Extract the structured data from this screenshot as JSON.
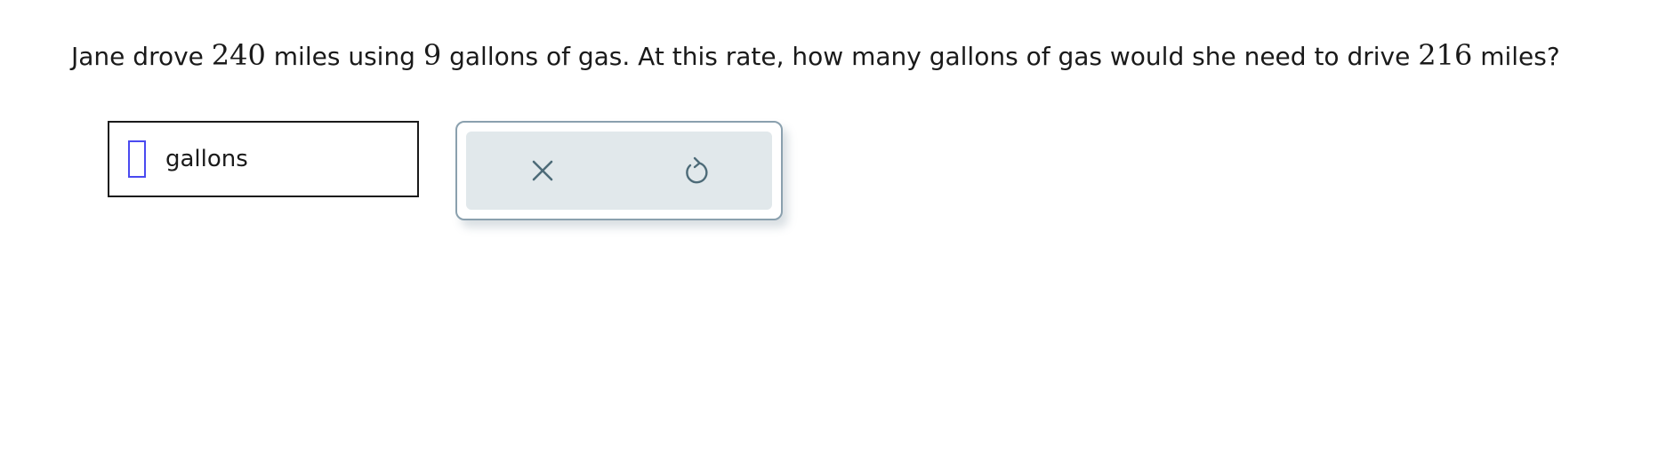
{
  "question": {
    "part1": "Jane drove ",
    "miles1": "240",
    "part2": " miles using ",
    "gallons": "9",
    "part3": " gallons of gas. At this rate, how many gallons of gas would she need to drive ",
    "miles2": "216",
    "part4": " miles?"
  },
  "answer": {
    "unit": "gallons",
    "value": ""
  },
  "keypad": {
    "clear_icon": "close-icon",
    "undo_icon": "undo-icon",
    "icon_color": "#4d6b78"
  },
  "colors": {
    "cursor": "#4a4af0",
    "keypad_border": "#8aa0ae",
    "keypad_bg": "#e1e8eb"
  }
}
